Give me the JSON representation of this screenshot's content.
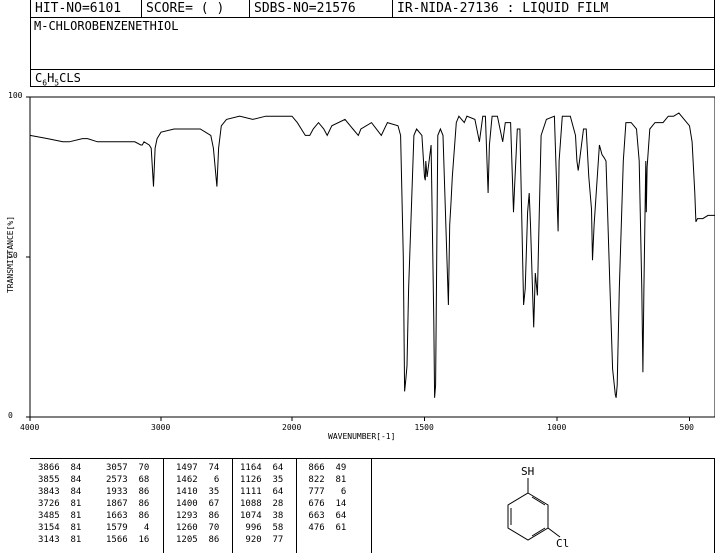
{
  "header": {
    "hit_no": "HIT-NO=6101",
    "score": "SCORE=  (   )",
    "sdbs_no": "SDBS-NO=21576",
    "ir_nida": "IR-NIDA-27136 : LIQUID FILM"
  },
  "compound_name": "M-CHLOROBENZENETHIOL",
  "formula": {
    "c": "C",
    "c_sub": "6",
    "h": "H",
    "h_sub": "5",
    "rest": "CLS"
  },
  "chart_data": {
    "type": "line",
    "xlabel": "WAVENUMBER[-1]",
    "ylabel": "TRANSMITTANCE[%]",
    "xlim": [
      4000,
      400
    ],
    "ylim": [
      0,
      100
    ],
    "x_ticks": [
      "4000",
      "3000",
      "2000",
      "1500",
      "1000",
      "500"
    ],
    "x_tick_values": [
      4000,
      3000,
      2000,
      1500,
      1000,
      500
    ],
    "y_ticks": [
      "100",
      "50",
      "0"
    ],
    "y_tick_values": [
      100,
      50,
      0
    ],
    "series": [
      {
        "points": [
          [
            4000,
            88
          ],
          [
            3866,
            87
          ],
          [
            3750,
            86
          ],
          [
            3700,
            86
          ],
          [
            3600,
            87
          ],
          [
            3560,
            87
          ],
          [
            3485,
            86
          ],
          [
            3420,
            86
          ],
          [
            3300,
            86
          ],
          [
            3250,
            86
          ],
          [
            3200,
            86
          ],
          [
            3154,
            85
          ],
          [
            3143,
            85
          ],
          [
            3130,
            86
          ],
          [
            3090,
            85
          ],
          [
            3075,
            84
          ],
          [
            3057,
            72
          ],
          [
            3045,
            84
          ],
          [
            3030,
            87
          ],
          [
            3000,
            89
          ],
          [
            2900,
            90
          ],
          [
            2800,
            90
          ],
          [
            2700,
            90
          ],
          [
            2620,
            88
          ],
          [
            2600,
            84
          ],
          [
            2573,
            72
          ],
          [
            2560,
            84
          ],
          [
            2540,
            91
          ],
          [
            2500,
            93
          ],
          [
            2400,
            94
          ],
          [
            2300,
            93
          ],
          [
            2200,
            94
          ],
          [
            2100,
            94
          ],
          [
            2000,
            94
          ],
          [
            1980,
            92
          ],
          [
            1950,
            88
          ],
          [
            1933,
            88
          ],
          [
            1920,
            90
          ],
          [
            1900,
            92
          ],
          [
            1880,
            90
          ],
          [
            1867,
            88
          ],
          [
            1850,
            91
          ],
          [
            1800,
            93
          ],
          [
            1770,
            90
          ],
          [
            1750,
            88
          ],
          [
            1740,
            90
          ],
          [
            1700,
            92
          ],
          [
            1663,
            88
          ],
          [
            1640,
            92
          ],
          [
            1600,
            91
          ],
          [
            1590,
            88
          ],
          [
            1580,
            50
          ],
          [
            1575,
            8
          ],
          [
            1570,
            12
          ],
          [
            1566,
            16
          ],
          [
            1560,
            40
          ],
          [
            1540,
            88
          ],
          [
            1530,
            90
          ],
          [
            1510,
            88
          ],
          [
            1500,
            75
          ],
          [
            1497,
            74
          ],
          [
            1495,
            80
          ],
          [
            1490,
            75
          ],
          [
            1475,
            85
          ],
          [
            1465,
            30
          ],
          [
            1462,
            6
          ],
          [
            1458,
            10
          ],
          [
            1450,
            88
          ],
          [
            1440,
            90
          ],
          [
            1430,
            88
          ],
          [
            1410,
            35
          ],
          [
            1405,
            60
          ],
          [
            1400,
            67
          ],
          [
            1395,
            75
          ],
          [
            1380,
            92
          ],
          [
            1370,
            94
          ],
          [
            1360,
            93
          ],
          [
            1350,
            92
          ],
          [
            1340,
            94
          ],
          [
            1310,
            93
          ],
          [
            1293,
            86
          ],
          [
            1280,
            94
          ],
          [
            1270,
            94
          ],
          [
            1260,
            70
          ],
          [
            1255,
            85
          ],
          [
            1245,
            94
          ],
          [
            1225,
            94
          ],
          [
            1205,
            86
          ],
          [
            1195,
            92
          ],
          [
            1175,
            92
          ],
          [
            1164,
            64
          ],
          [
            1160,
            72
          ],
          [
            1150,
            90
          ],
          [
            1140,
            90
          ],
          [
            1126,
            35
          ],
          [
            1120,
            40
          ],
          [
            1111,
            64
          ],
          [
            1105,
            70
          ],
          [
            1100,
            60
          ],
          [
            1088,
            28
          ],
          [
            1082,
            45
          ],
          [
            1074,
            38
          ],
          [
            1068,
            60
          ],
          [
            1060,
            88
          ],
          [
            1040,
            93
          ],
          [
            1010,
            94
          ],
          [
            996,
            58
          ],
          [
            992,
            80
          ],
          [
            980,
            94
          ],
          [
            950,
            94
          ],
          [
            930,
            88
          ],
          [
            925,
            80
          ],
          [
            920,
            77
          ],
          [
            915,
            80
          ],
          [
            900,
            90
          ],
          [
            890,
            90
          ],
          [
            880,
            75
          ],
          [
            870,
            65
          ],
          [
            866,
            49
          ],
          [
            860,
            60
          ],
          [
            840,
            85
          ],
          [
            830,
            82
          ],
          [
            822,
            81
          ],
          [
            815,
            80
          ],
          [
            800,
            40
          ],
          [
            790,
            15
          ],
          [
            780,
            7
          ],
          [
            777,
            6
          ],
          [
            773,
            10
          ],
          [
            765,
            40
          ],
          [
            750,
            80
          ],
          [
            740,
            92
          ],
          [
            720,
            92
          ],
          [
            700,
            90
          ],
          [
            690,
            80
          ],
          [
            680,
            40
          ],
          [
            676,
            14
          ],
          [
            672,
            40
          ],
          [
            665,
            80
          ],
          [
            663,
            64
          ],
          [
            660,
            78
          ],
          [
            650,
            90
          ],
          [
            630,
            92
          ],
          [
            600,
            92
          ],
          [
            580,
            94
          ],
          [
            560,
            94
          ],
          [
            540,
            95
          ],
          [
            520,
            93
          ],
          [
            500,
            91
          ],
          [
            490,
            86
          ],
          [
            480,
            70
          ],
          [
            476,
            61
          ],
          [
            470,
            62
          ],
          [
            450,
            62
          ],
          [
            430,
            63
          ],
          [
            400,
            63
          ]
        ]
      }
    ]
  },
  "peak_table": [
    [
      "3866",
      "84"
    ],
    [
      "3855",
      "84"
    ],
    [
      "3843",
      "84"
    ],
    [
      "3726",
      "81"
    ],
    [
      "3485",
      "81"
    ],
    [
      "3154",
      "81"
    ],
    [
      "3143",
      "81"
    ],
    [
      "3057",
      "70"
    ],
    [
      "2573",
      "68"
    ],
    [
      "1933",
      "86"
    ],
    [
      "1867",
      "86"
    ],
    [
      "1663",
      "86"
    ],
    [
      "1579",
      "4"
    ],
    [
      "1566",
      "16"
    ],
    [
      "1497",
      "74"
    ],
    [
      "1462",
      "6"
    ],
    [
      "1410",
      "35"
    ],
    [
      "1400",
      "67"
    ],
    [
      "1293",
      "86"
    ],
    [
      "1260",
      "70"
    ],
    [
      "1205",
      "86"
    ],
    [
      "1164",
      "64"
    ],
    [
      "1126",
      "35"
    ],
    [
      "1111",
      "64"
    ],
    [
      "1088",
      "28"
    ],
    [
      "1074",
      "38"
    ],
    [
      "996",
      "58"
    ],
    [
      "920",
      "77"
    ],
    [
      "866",
      "49"
    ],
    [
      "822",
      "81"
    ],
    [
      "777",
      "6"
    ],
    [
      "676",
      "14"
    ],
    [
      "663",
      "64"
    ],
    [
      "476",
      "61"
    ]
  ],
  "structure": {
    "sh_label": "SH",
    "cl_label": "Cl"
  }
}
